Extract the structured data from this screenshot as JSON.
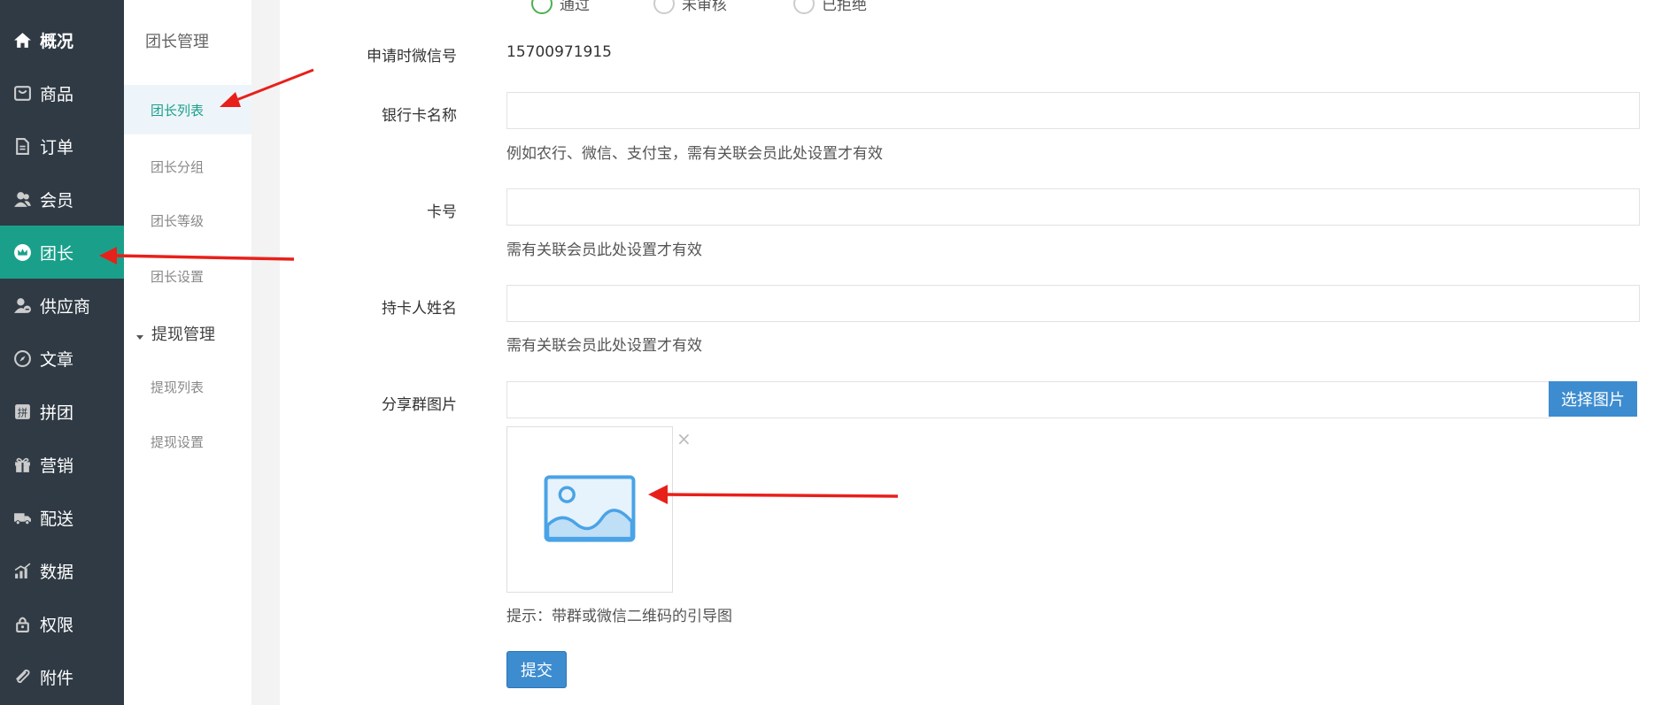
{
  "sidebar": {
    "items": [
      {
        "label": "概况",
        "icon": "home-icon"
      },
      {
        "label": "商品",
        "icon": "bag-icon"
      },
      {
        "label": "订单",
        "icon": "document-icon"
      },
      {
        "label": "会员",
        "icon": "users-icon"
      },
      {
        "label": "团长",
        "icon": "crown-icon",
        "active": true
      },
      {
        "label": "供应商",
        "icon": "supplier-icon"
      },
      {
        "label": "文章",
        "icon": "compass-icon"
      },
      {
        "label": "拼团",
        "icon": "group-icon"
      },
      {
        "label": "营销",
        "icon": "gift-icon"
      },
      {
        "label": "配送",
        "icon": "truck-icon"
      },
      {
        "label": "数据",
        "icon": "chart-icon"
      },
      {
        "label": "权限",
        "icon": "lock-icon"
      },
      {
        "label": "附件",
        "icon": "paperclip-icon"
      }
    ]
  },
  "submenu": {
    "section1_title": "团长管理",
    "section1_items": [
      "团长列表",
      "团长分组",
      "团长等级",
      "团长设置"
    ],
    "section2_title": "提现管理",
    "section2_items": [
      "提现列表",
      "提现设置"
    ]
  },
  "form": {
    "status_options": [
      "通过",
      "未审核",
      "已拒绝"
    ],
    "wechat_label": "申请时微信号",
    "wechat_value": "15700971915",
    "bank_name_label": "银行卡名称",
    "bank_name_value": "",
    "bank_name_hint": "例如农行、微信、支付宝，需有关联会员此处设置才有效",
    "card_no_label": "卡号",
    "card_no_value": "",
    "card_no_hint": "需有关联会员此处设置才有效",
    "holder_label": "持卡人姓名",
    "holder_value": "",
    "holder_hint": "需有关联会员此处设置才有效",
    "share_img_label": "分享群图片",
    "share_img_value": "",
    "pick_button": "选择图片",
    "close_glyph": "×",
    "share_img_hint": "提示：带群或微信二维码的引导图",
    "submit_button": "提交"
  },
  "colors": {
    "sidebar_bg": "#2f3a44",
    "active_green": "#1aa08a",
    "button_blue": "#3d8cd0",
    "annotation_red": "#e8201a"
  }
}
